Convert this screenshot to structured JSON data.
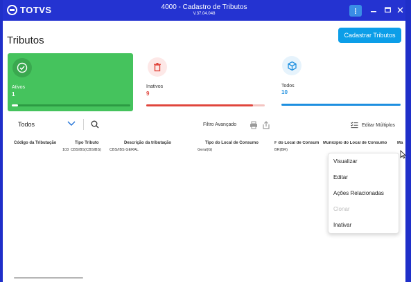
{
  "window": {
    "brand": "TOTVS",
    "title": "4000 - Cadastro de Tributos",
    "version": "V.37.04.048",
    "controls": [
      "minimize",
      "maximize",
      "close"
    ]
  },
  "page": {
    "title": "Tributos",
    "primary_action": "Cadastrar Tributos"
  },
  "cards": [
    {
      "label": "Ativos",
      "count": "1",
      "icon": "check-badge-icon",
      "progress": 0.05,
      "color": "#45c35d"
    },
    {
      "label": "Inativos",
      "count": "9",
      "icon": "trash-icon",
      "progress": 0.9,
      "color": "#e0463d"
    },
    {
      "label": "Todos",
      "count": "10",
      "icon": "box-icon",
      "progress": 1.0,
      "color": "#1d8fe0"
    }
  ],
  "toolbar": {
    "filter_value": "Todos",
    "advanced_filter": "Filtro Avançado",
    "edit_multiple": "Editar Múltiplos"
  },
  "table": {
    "columns": [
      "Código da Tributação",
      "Tipo Tributo",
      "Descrição da tributação",
      "Tipo do Local de Consumo",
      "F do Local de Consum",
      "Município do Local de Consumo",
      "Ma"
    ],
    "rows": [
      [
        "103",
        "CBSIBS(CBSIBS)",
        "CBS/IBS GERAL",
        "Geral(G)",
        "BR(BR)",
        "",
        ""
      ]
    ]
  },
  "context_menu": {
    "items": [
      {
        "label": "Visualizar",
        "disabled": false
      },
      {
        "label": "Editar",
        "disabled": false
      },
      {
        "label": "Ações Relacionadas",
        "disabled": false
      },
      {
        "label": "Clonar",
        "disabled": true
      },
      {
        "label": "Inativar",
        "disabled": false
      }
    ]
  }
}
